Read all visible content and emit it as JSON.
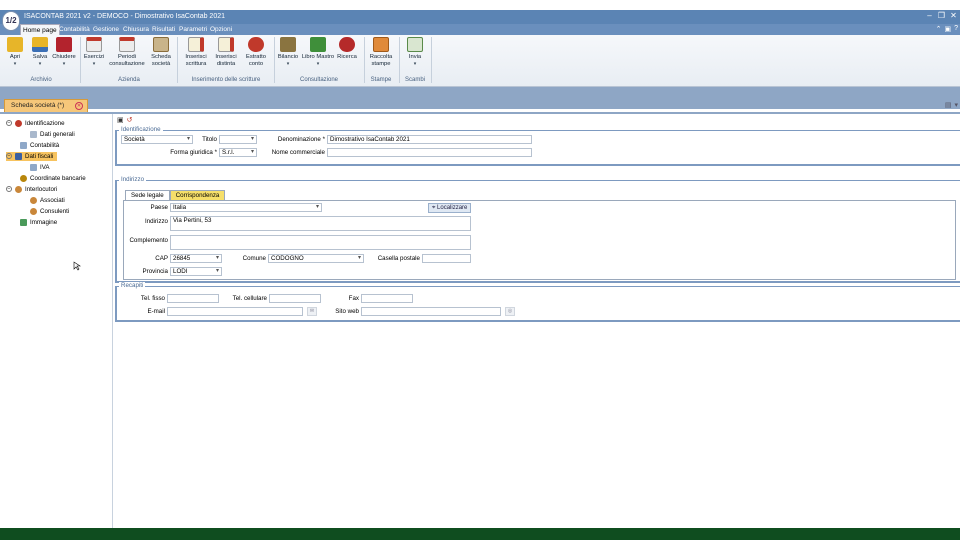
{
  "window": {
    "title": "ISACONTAB 2021 v2 - DEMOCO - Dimostrativo IsaContab 2021",
    "logo_text": "1/2"
  },
  "menu": {
    "tabs": [
      "Home page",
      "Contabilità",
      "Gestione",
      "Chiusura",
      "Risultati",
      "Parametri",
      "Opzioni"
    ]
  },
  "ribbon": {
    "archivio": {
      "label": "Archivio",
      "apri": "Apri",
      "salva": "Salva",
      "chiudere": "Chiudere"
    },
    "azienda": {
      "label": "Azienda",
      "esercizi": "Esercizi",
      "periodi": "Periodi consultazione",
      "scheda": "Scheda società"
    },
    "inserimento": {
      "label": "Inserimento delle scritture",
      "scrittura": "Inserisci scrittura",
      "distinta": "Inserisci distinta",
      "estratto": "Estratto conto"
    },
    "consultazione": {
      "label": "Consultazione",
      "bilancio": "Bilancio",
      "libro": "Libro Mastro",
      "ricerca": "Ricerca"
    },
    "stampe": {
      "label": "Stampe",
      "raccolta": "Raccolta stampe"
    },
    "scambi": {
      "label": "Scambi",
      "invia": "Invia"
    }
  },
  "doc_tab": {
    "label": "Scheda società (*)"
  },
  "tree": {
    "identificazione": "Identificazione",
    "dati_generali": "Dati generali",
    "contabilita": "Contabilità",
    "dati_fiscali": "Dati fiscali",
    "iva": "IVA",
    "coordinate": "Coordinate bancarie",
    "interlocutori": "Interlocutori",
    "associati": "Associati",
    "consulenti": "Consulenti",
    "immagine": "Immagine"
  },
  "identificazione": {
    "legend": "Identificazione",
    "tipo_value": "Società",
    "titolo_label": "Titolo",
    "titolo_value": "",
    "denominazione_label": "Denominazione *",
    "denominazione_value": "Dimostrativo IsaContab 2021",
    "forma_label": "Forma giuridica *",
    "forma_value": "S.r.l.",
    "nome_commerciale_label": "Nome commerciale",
    "nome_commerciale_value": ""
  },
  "indirizzo": {
    "legend": "Indirizzo",
    "tab_sede": "Sede legale",
    "tab_corrispondenza": "Corrispondenza",
    "paese_label": "Paese",
    "paese_value": "Italia",
    "localizzare": "Localizzare",
    "indirizzo_label": "Indirizzo",
    "indirizzo_value": "Via Pertini, 53",
    "complemento_label": "Complemento",
    "complemento_value": "",
    "cap_label": "CAP",
    "cap_value": "26845",
    "comune_label": "Comune",
    "comune_value": "CODOGNO",
    "casella_label": "Casella postale",
    "casella_value": "",
    "provincia_label": "Provincia",
    "provincia_value": "LODI"
  },
  "recapiti": {
    "legend": "Recapiti",
    "tel_fisso_label": "Tel. fisso",
    "tel_fisso_value": "",
    "tel_cell_label": "Tel. cellulare",
    "tel_cell_value": "",
    "fax_label": "Fax",
    "fax_value": "",
    "email_label": "E-mail",
    "email_value": "",
    "sito_label": "Sito web",
    "sito_value": ""
  },
  "colors": {
    "accent": "#5b84b4",
    "selection": "#f7c35f",
    "status_bar": "#0f4d1f"
  }
}
